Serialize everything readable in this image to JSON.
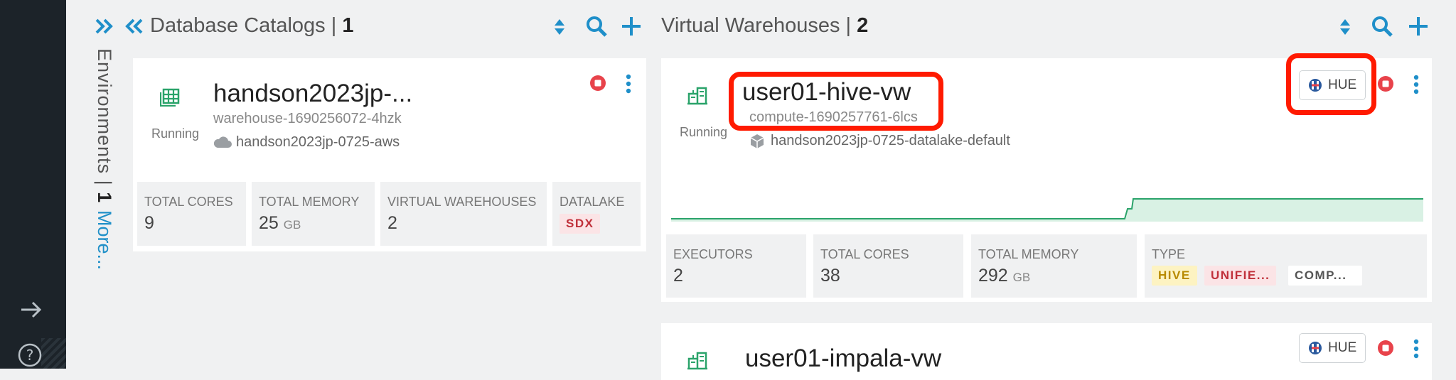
{
  "environments": {
    "label": "Environments | ",
    "count": "1",
    "more": "More..."
  },
  "catalogs": {
    "header_label": "Database Catalogs | ",
    "header_count": "1",
    "card": {
      "title": "handson2023jp-...",
      "subtitle": "warehouse-1690256072-4hzk",
      "environment": "handson2023jp-0725-aws",
      "status": "Running",
      "stats": [
        {
          "label": "TOTAL CORES",
          "value": "9",
          "unit": ""
        },
        {
          "label": "TOTAL MEMORY",
          "value": "25",
          "unit": "GB"
        },
        {
          "label": "VIRTUAL WAREHOUSES",
          "value": "2",
          "unit": ""
        },
        {
          "label": "DATALAKE",
          "badge": "SDX"
        }
      ]
    }
  },
  "warehouses": {
    "header_label": "Virtual Warehouses | ",
    "header_count": "2",
    "cards": [
      {
        "title": "user01-hive-vw",
        "subtitle": "compute-1690257761-6lcs",
        "datalake": "handson2023jp-0725-datalake-default",
        "status": "Running",
        "hue_label": "HUE",
        "stats": [
          {
            "label": "EXECUTORS",
            "value": "2",
            "unit": ""
          },
          {
            "label": "TOTAL CORES",
            "value": "38",
            "unit": ""
          },
          {
            "label": "TOTAL MEMORY",
            "value": "292",
            "unit": "GB"
          },
          {
            "label": "TYPE",
            "badges": [
              "HIVE",
              "UNIFIE...",
              "COMP..."
            ]
          }
        ]
      },
      {
        "title": "user01-impala-vw",
        "hue_label": "HUE"
      }
    ]
  },
  "colors": {
    "accent": "#1f8fc9",
    "running_green": "#2aa36a",
    "stop_red": "#e8434b",
    "highlight": "#ff1a00"
  }
}
